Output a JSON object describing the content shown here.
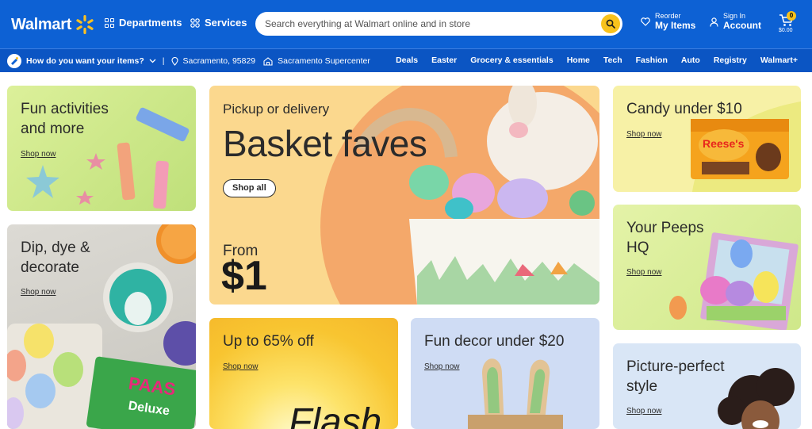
{
  "header": {
    "logo_text": "Walmart",
    "departments_label": "Departments",
    "services_label": "Services",
    "search_placeholder": "Search everything at Walmart online and in store",
    "reorder_small": "Reorder",
    "reorder_big": "My Items",
    "signin_small": "Sign In",
    "signin_big": "Account",
    "cart_count": "0",
    "cart_total": "$0.00"
  },
  "subbar": {
    "delivery_question": "How do you want your items?",
    "divider": "|",
    "location": "Sacramento, 95829",
    "store": "Sacramento Supercenter",
    "links": [
      "Deals",
      "Easter",
      "Grocery & essentials",
      "Home",
      "Tech",
      "Fashion",
      "Auto",
      "Registry",
      "Walmart+"
    ]
  },
  "cards": {
    "fun_activities": {
      "title": "Fun activities and more",
      "link": "Shop now"
    },
    "dip_dye": {
      "title": "Dip, dye & decorate",
      "link": "Shop now"
    },
    "basket": {
      "eyebrow": "Pickup or delivery",
      "title": "Basket faves",
      "button": "Shop all",
      "from": "From",
      "price": "$1"
    },
    "candy": {
      "title": "Candy under $10",
      "link": "Shop now"
    },
    "peeps": {
      "title": "Your Peeps HQ",
      "link": "Shop now"
    },
    "flash": {
      "title": "Up to 65% off",
      "link": "Shop now",
      "big_text": "Flash"
    },
    "decor": {
      "title": "Fun decor under $20",
      "link": "Shop now"
    },
    "picture": {
      "title": "Picture-perfect style",
      "link": "Shop now"
    }
  },
  "colors": {
    "brand_blue": "#0d61d4",
    "spark_yellow": "#ffc220"
  }
}
